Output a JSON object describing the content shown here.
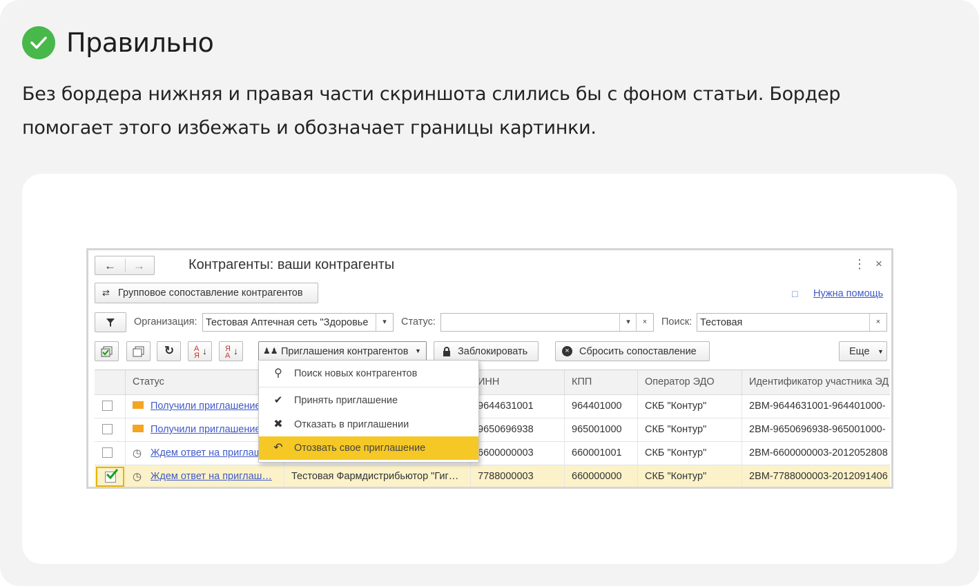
{
  "article": {
    "heading": "Правильно",
    "description": "Без бордера нижняя и правая части скриншота слились бы с фоном статьи. Бордер помогает этого избежать и обозначает границы картинки."
  },
  "window": {
    "title": "Контрагенты: ваши контрагенты",
    "help_link": "Нужна помощь",
    "group_match_button": "Групповое сопоставление контрагентов"
  },
  "filters": {
    "org_label": "Организация:",
    "org_value": "Тестовая Аптечная сеть \"Здоровье",
    "status_label": "Статус:",
    "status_value": "",
    "search_label": "Поиск:",
    "search_value": "Тестовая"
  },
  "toolbar": {
    "invitations": "Приглашения контрагентов",
    "block": "Заблокировать",
    "reset": "Сбросить сопоставление",
    "more": "Еще"
  },
  "menu": {
    "items": [
      {
        "label": "Поиск новых контрагентов",
        "icon": "search-icon"
      },
      {
        "label": "Принять приглашение",
        "icon": "check-icon"
      },
      {
        "label": "Отказать в приглашении",
        "icon": "cross-icon"
      },
      {
        "label": "Отозвать свое приглашение",
        "icon": "undo-icon",
        "highlighted": true
      }
    ]
  },
  "table": {
    "columns": [
      "Статус",
      "",
      "ИНН",
      "КПП",
      "Оператор ЭДО",
      "Идентификатор участника ЭД"
    ],
    "rows": [
      {
        "checked": false,
        "status_icon": "envelope-icon",
        "status": "Получили приглашение",
        "name": "",
        "inn": "9644631001",
        "kpp": "964401000",
        "operator": "СКБ \"Контур\"",
        "id": "2BM-9644631001-964401000-"
      },
      {
        "checked": false,
        "status_icon": "envelope-icon",
        "status": "Получили приглашение",
        "name": "",
        "inn": "9650696938",
        "kpp": "965001000",
        "operator": "СКБ \"Контур\"",
        "id": "2BM-9650696938-965001000-"
      },
      {
        "checked": false,
        "status_icon": "clock-icon",
        "status": "Ждем ответ на приглашение",
        "name": "",
        "inn": "6600000003",
        "kpp": "660001001",
        "operator": "СКБ \"Контур\"",
        "id": "2BM-6600000003-2012052808"
      },
      {
        "checked": true,
        "status_icon": "clock-icon",
        "status": "Ждем ответ на приглаш…",
        "name": "Тестовая Фармдистрибьютор \"Гиг…",
        "inn": "7788000003",
        "kpp": "660000000",
        "operator": "СКБ \"Контур\"",
        "id": "2BM-7788000003-2012091406"
      }
    ]
  },
  "colors": {
    "accent_green": "#49b84a",
    "highlight_yellow": "#f6c825",
    "selected_row": "#fcf2c9",
    "link": "#3f59c9"
  }
}
